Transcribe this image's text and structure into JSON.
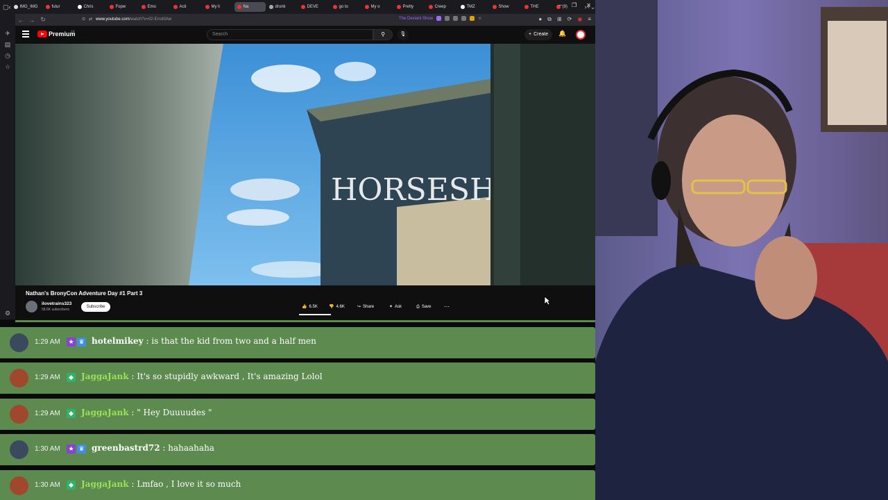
{
  "browser": {
    "tabs": [
      {
        "label": "IMG_IMG",
        "color": "#ddd"
      },
      {
        "label": "futur",
        "color": "#e33"
      },
      {
        "label": "Chris",
        "color": "#fff"
      },
      {
        "label": "Fopw",
        "color": "#e33"
      },
      {
        "label": "Emo",
        "color": "#e33"
      },
      {
        "label": "Acti",
        "color": "#e33"
      },
      {
        "label": "My li",
        "color": "#e33"
      },
      {
        "label": "Na",
        "color": "#e33"
      },
      {
        "label": "drunk",
        "color": "#aaa"
      },
      {
        "label": "DEVE",
        "color": "#e33"
      },
      {
        "label": "go to",
        "color": "#e33"
      },
      {
        "label": "My o",
        "color": "#e33"
      },
      {
        "label": "Pretty",
        "color": "#e33"
      },
      {
        "label": "Creep",
        "color": "#e33"
      },
      {
        "label": "TMZ",
        "color": "#fff"
      },
      {
        "label": "Show",
        "color": "#e33"
      },
      {
        "label": "THE",
        "color": "#e33"
      },
      {
        "label": "(9)",
        "color": "#e33"
      }
    ],
    "url_host": "www.youtube.com",
    "url_path": "/watch?v=02-Errot0Aw",
    "bookmark_label": "The Deviant Show"
  },
  "youtube": {
    "brand": "Premium",
    "region": "CA",
    "search_placeholder": "Search",
    "create_label": "Create",
    "video_title": "Nathan's BronyCon Adventure Day #1 Part 3",
    "video_sign_text": "HORSESH",
    "channel_name": "ilovetrains323",
    "channel_subs": "58.6K subscribers",
    "subscribe_label": "Subscribe",
    "likes": "6.5K",
    "dislikes": "4.6K",
    "share_label": "Share",
    "ask_label": "Ask",
    "save_label": "Save"
  },
  "chat": {
    "messages": [
      {
        "time": "1:29 AM",
        "user": "hotelmikey",
        "text": "is that the kid from two and a half men",
        "user_color": "#ffffff",
        "badges": [
          "purple-star",
          "blue-crown"
        ]
      },
      {
        "time": "1:29 AM",
        "user": "JaggaJank",
        "text": "It's so stupidly awkward , It's amazing Lolol",
        "user_color": "#9be25a",
        "badges": [
          "green-gem"
        ]
      },
      {
        "time": "1:29 AM",
        "user": "JaggaJank",
        "text": "\" Hey Duuuudes \"",
        "user_color": "#9be25a",
        "badges": [
          "green-gem"
        ]
      },
      {
        "time": "1:30 AM",
        "user": "greenbastrd72",
        "text": "hahaahaha",
        "user_color": "#ffffff",
        "badges": [
          "purple-star",
          "blue-crown"
        ]
      },
      {
        "time": "1:30 AM",
        "user": "JaggaJank",
        "text": "Lmfao , I love it so much",
        "user_color": "#9be25a",
        "badges": [
          "green-gem"
        ]
      }
    ]
  }
}
